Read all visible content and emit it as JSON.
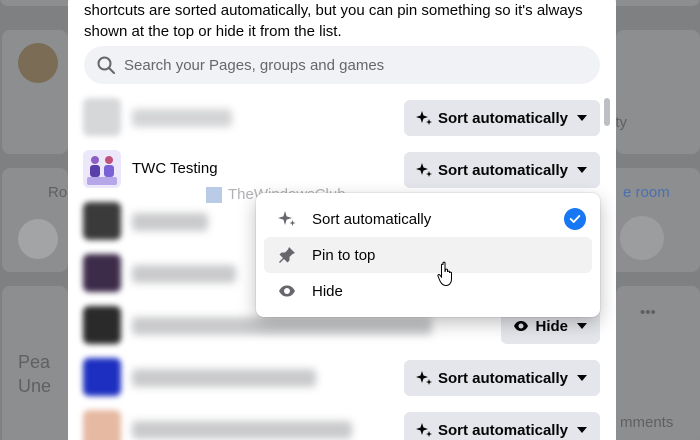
{
  "modal": {
    "intro_text": "shortcuts are sorted automatically, but you can pin something so it's always shown at the top or hide it from the list.",
    "search_placeholder": "Search your Pages, groups and games"
  },
  "shortcuts": [
    {
      "name": "",
      "button": "Sort automatically",
      "thumb_color": "#d6d7d9"
    },
    {
      "name": "TWC Testing",
      "button": "Sort automatically",
      "thumb_color": "#9b8fd0"
    },
    {
      "name": "",
      "button": "Sort automatically",
      "thumb_color": "#3a3a3a"
    },
    {
      "name": "",
      "button": "Sort automatically",
      "thumb_color": "#3d2b4a"
    },
    {
      "name": "",
      "button": "Hide",
      "thumb_color": "#2a2a2a"
    },
    {
      "name": "",
      "button": "Sort automatically",
      "thumb_color": "#1d2fc0"
    },
    {
      "name": "",
      "button": "Sort automatically",
      "thumb_color": "#e6b9a3"
    }
  ],
  "menu": {
    "items": [
      "Sort automatically",
      "Pin to top",
      "Hide"
    ],
    "selected": "Sort automatically",
    "hovered": "Pin to top"
  },
  "watermark": "TheWindowsClub",
  "background": {
    "room_left": "Ro",
    "room_right": "e room",
    "side_text": "ity",
    "comments_text": "mments",
    "feed_text_1": "Pea",
    "feed_text_2": "Une"
  },
  "colors": {
    "accent": "#1877f2",
    "button_bg": "#e4e6eb",
    "search_bg": "#f0f2f5",
    "overlay": "#7f8081"
  }
}
